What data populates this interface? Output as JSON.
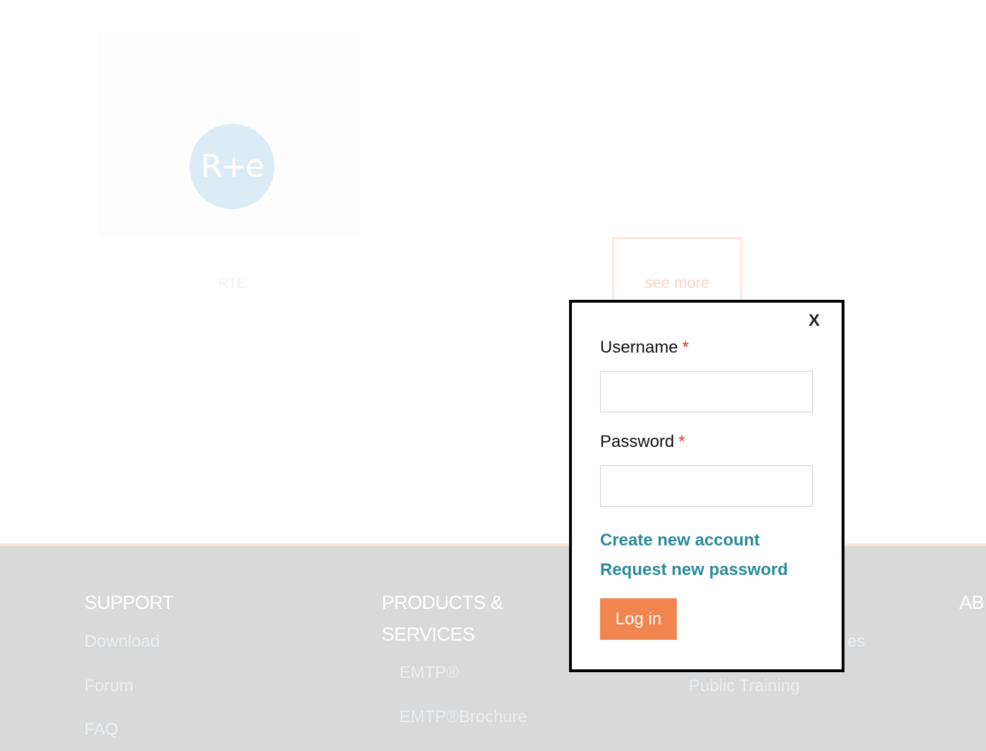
{
  "background": {
    "logo_text": "R+e",
    "card_caption": "RTE",
    "see_more_label": "see more"
  },
  "footer": {
    "support": {
      "title": "SUPPORT",
      "links": [
        "Download",
        "Forum",
        "FAQ"
      ]
    },
    "products": {
      "title_line1": "PRODUCTS &",
      "title_line2": "SERVICES",
      "links": [
        "EMTP®",
        "EMTP®Brochure"
      ]
    },
    "training": {
      "links": [
        "es",
        "Public Training"
      ]
    },
    "about": {
      "title": "AB"
    }
  },
  "login": {
    "close_label": "X",
    "username_label": "Username",
    "password_label": "Password",
    "required_mark": "*",
    "username_value": "",
    "password_value": "",
    "create_account": "Create new account",
    "request_password": "Request new password",
    "submit": "Log in"
  },
  "colors": {
    "accent": "#f0854f",
    "link": "#2b8a99",
    "required": "#e0322a"
  }
}
